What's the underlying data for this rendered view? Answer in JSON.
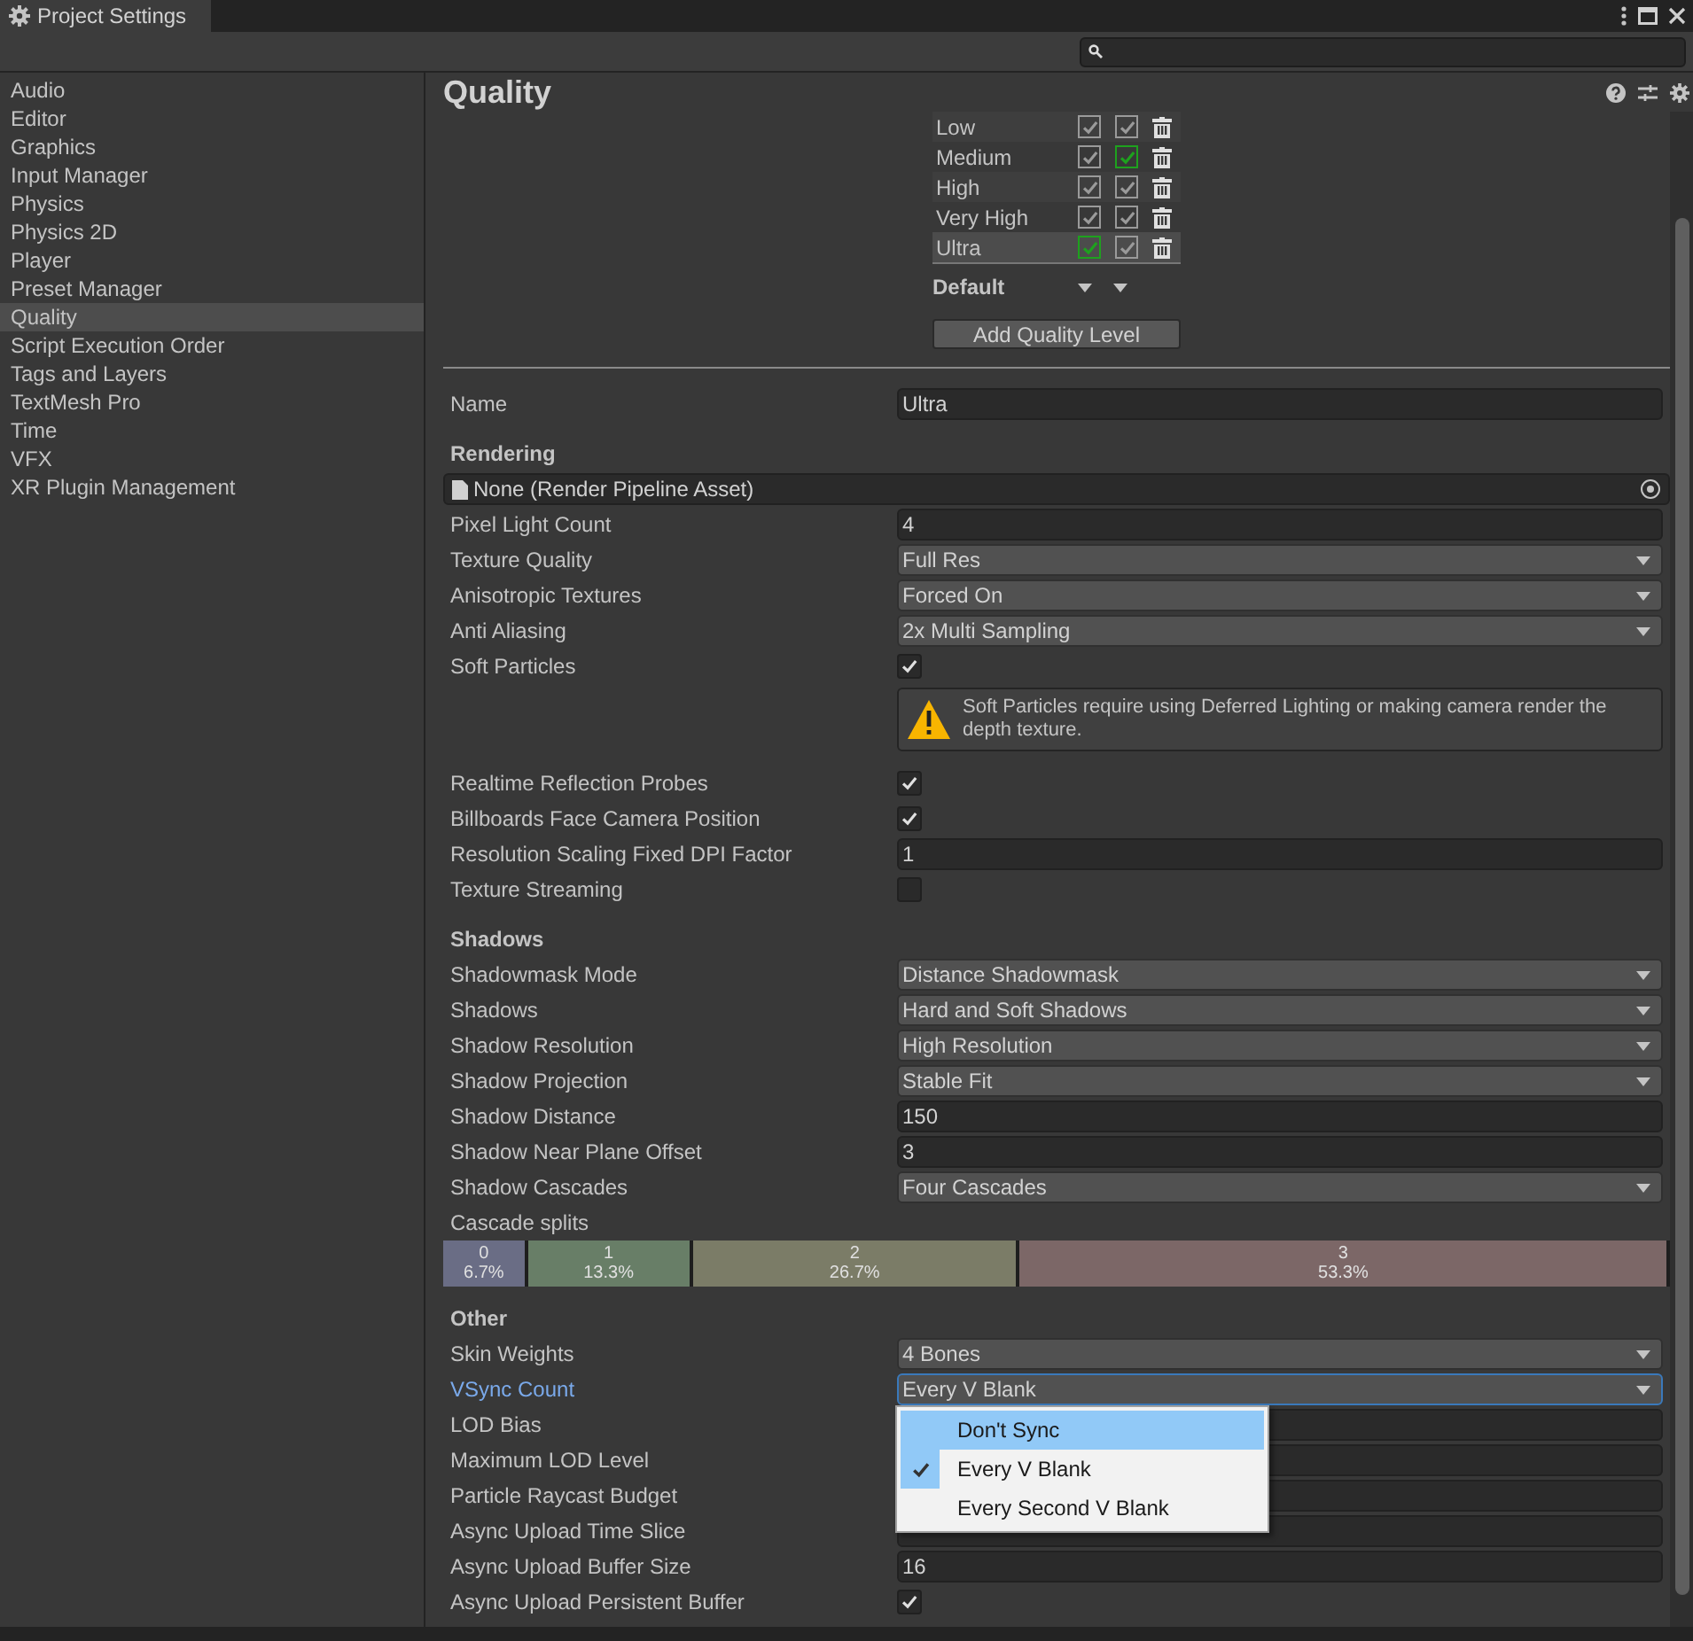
{
  "window": {
    "title": "Project Settings"
  },
  "search": {
    "kind": "search"
  },
  "sidebar": {
    "items": [
      {
        "label": "Audio",
        "selected": false
      },
      {
        "label": "Editor",
        "selected": false
      },
      {
        "label": "Graphics",
        "selected": false
      },
      {
        "label": "Input Manager",
        "selected": false
      },
      {
        "label": "Physics",
        "selected": false
      },
      {
        "label": "Physics 2D",
        "selected": false
      },
      {
        "label": "Player",
        "selected": false
      },
      {
        "label": "Preset Manager",
        "selected": false
      },
      {
        "label": "Quality",
        "selected": true
      },
      {
        "label": "Script Execution Order",
        "selected": false
      },
      {
        "label": "Tags and Layers",
        "selected": false
      },
      {
        "label": "TextMesh Pro",
        "selected": false
      },
      {
        "label": "Time",
        "selected": false
      },
      {
        "label": "VFX",
        "selected": false
      },
      {
        "label": "XR Plugin Management",
        "selected": false
      }
    ]
  },
  "page": {
    "title": "Quality"
  },
  "quality_levels": [
    {
      "name": "Low",
      "selected": false,
      "platforms": [
        {
          "checked": true,
          "color": "#9a9a9a"
        },
        {
          "checked": true,
          "color": "#9a9a9a"
        }
      ]
    },
    {
      "name": "Medium",
      "selected": false,
      "platforms": [
        {
          "checked": true,
          "color": "#9a9a9a"
        },
        {
          "checked": true,
          "color": "#1ea11e"
        }
      ]
    },
    {
      "name": "High",
      "selected": false,
      "platforms": [
        {
          "checked": true,
          "color": "#9a9a9a"
        },
        {
          "checked": true,
          "color": "#9a9a9a"
        }
      ]
    },
    {
      "name": "Very High",
      "selected": false,
      "platforms": [
        {
          "checked": true,
          "color": "#9a9a9a"
        },
        {
          "checked": true,
          "color": "#9a9a9a"
        }
      ]
    },
    {
      "name": "Ultra",
      "selected": true,
      "platforms": [
        {
          "checked": true,
          "color": "#1ea11e"
        },
        {
          "checked": true,
          "color": "#9a9a9a"
        }
      ]
    }
  ],
  "default_row": {
    "label": "Default"
  },
  "add_button": {
    "label": "Add Quality Level"
  },
  "settings": [
    {
      "kind": "text",
      "label": "Name",
      "value": "Ultra"
    },
    {
      "kind": "header",
      "label": "Rendering"
    },
    {
      "kind": "object",
      "value": "None (Render Pipeline Asset)"
    },
    {
      "kind": "text",
      "label": "Pixel Light Count",
      "value": "4"
    },
    {
      "kind": "dropdown",
      "label": "Texture Quality",
      "value": "Full Res"
    },
    {
      "kind": "dropdown",
      "label": "Anisotropic Textures",
      "value": "Forced On"
    },
    {
      "kind": "dropdown",
      "label": "Anti Aliasing",
      "value": "2x Multi Sampling"
    },
    {
      "kind": "checkbox",
      "label": "Soft Particles",
      "checked": true
    },
    {
      "kind": "warning",
      "value": "Soft Particles require using Deferred Lighting or making camera render the depth texture."
    },
    {
      "kind": "checkbox",
      "label": "Realtime Reflection Probes",
      "checked": true
    },
    {
      "kind": "checkbox",
      "label": "Billboards Face Camera Position",
      "checked": true
    },
    {
      "kind": "text",
      "label": "Resolution Scaling Fixed DPI Factor",
      "value": "1"
    },
    {
      "kind": "checkbox",
      "label": "Texture Streaming",
      "checked": false
    },
    {
      "kind": "header",
      "label": "Shadows"
    },
    {
      "kind": "dropdown",
      "label": "Shadowmask Mode",
      "value": "Distance Shadowmask"
    },
    {
      "kind": "dropdown",
      "label": "Shadows",
      "value": "Hard and Soft Shadows"
    },
    {
      "kind": "dropdown",
      "label": "Shadow Resolution",
      "value": "High Resolution"
    },
    {
      "kind": "dropdown",
      "label": "Shadow Projection",
      "value": "Stable Fit"
    },
    {
      "kind": "text",
      "label": "Shadow Distance",
      "value": "150"
    },
    {
      "kind": "text",
      "label": "Shadow Near Plane Offset",
      "value": "3"
    },
    {
      "kind": "dropdown",
      "label": "Shadow Cascades",
      "value": "Four Cascades"
    },
    {
      "kind": "cascades",
      "label": "Cascade splits",
      "segments": [
        {
          "index": "0",
          "percent": "6.7%",
          "color": "#6a6d85"
        },
        {
          "index": "1",
          "percent": "13.3%",
          "color": "#687e67"
        },
        {
          "index": "2",
          "percent": "26.7%",
          "color": "#7b7c67"
        },
        {
          "index": "3",
          "percent": "53.3%",
          "color": "#7c6767"
        }
      ]
    },
    {
      "kind": "header",
      "label": "Other"
    },
    {
      "kind": "dropdown",
      "label": "Skin Weights",
      "value": "4 Bones"
    },
    {
      "kind": "dropdown",
      "label": "VSync Count",
      "value": "Every V Blank",
      "focused": true,
      "menu": [
        {
          "label": "Don't Sync",
          "selected": false,
          "hovered": true
        },
        {
          "label": "Every V Blank",
          "selected": true,
          "hovered": false
        },
        {
          "label": "Every Second V Blank",
          "selected": false,
          "hovered": false
        }
      ]
    },
    {
      "kind": "text",
      "label": "LOD Bias"
    },
    {
      "kind": "text",
      "label": "Maximum LOD Level"
    },
    {
      "kind": "text",
      "label": "Particle Raycast Budget"
    },
    {
      "kind": "text",
      "label": "Async Upload Time Slice"
    },
    {
      "kind": "text",
      "label": "Async Upload Buffer Size",
      "value": "16"
    },
    {
      "kind": "checkbox",
      "label": "Async Upload Persistent Buffer",
      "checked": true
    }
  ]
}
